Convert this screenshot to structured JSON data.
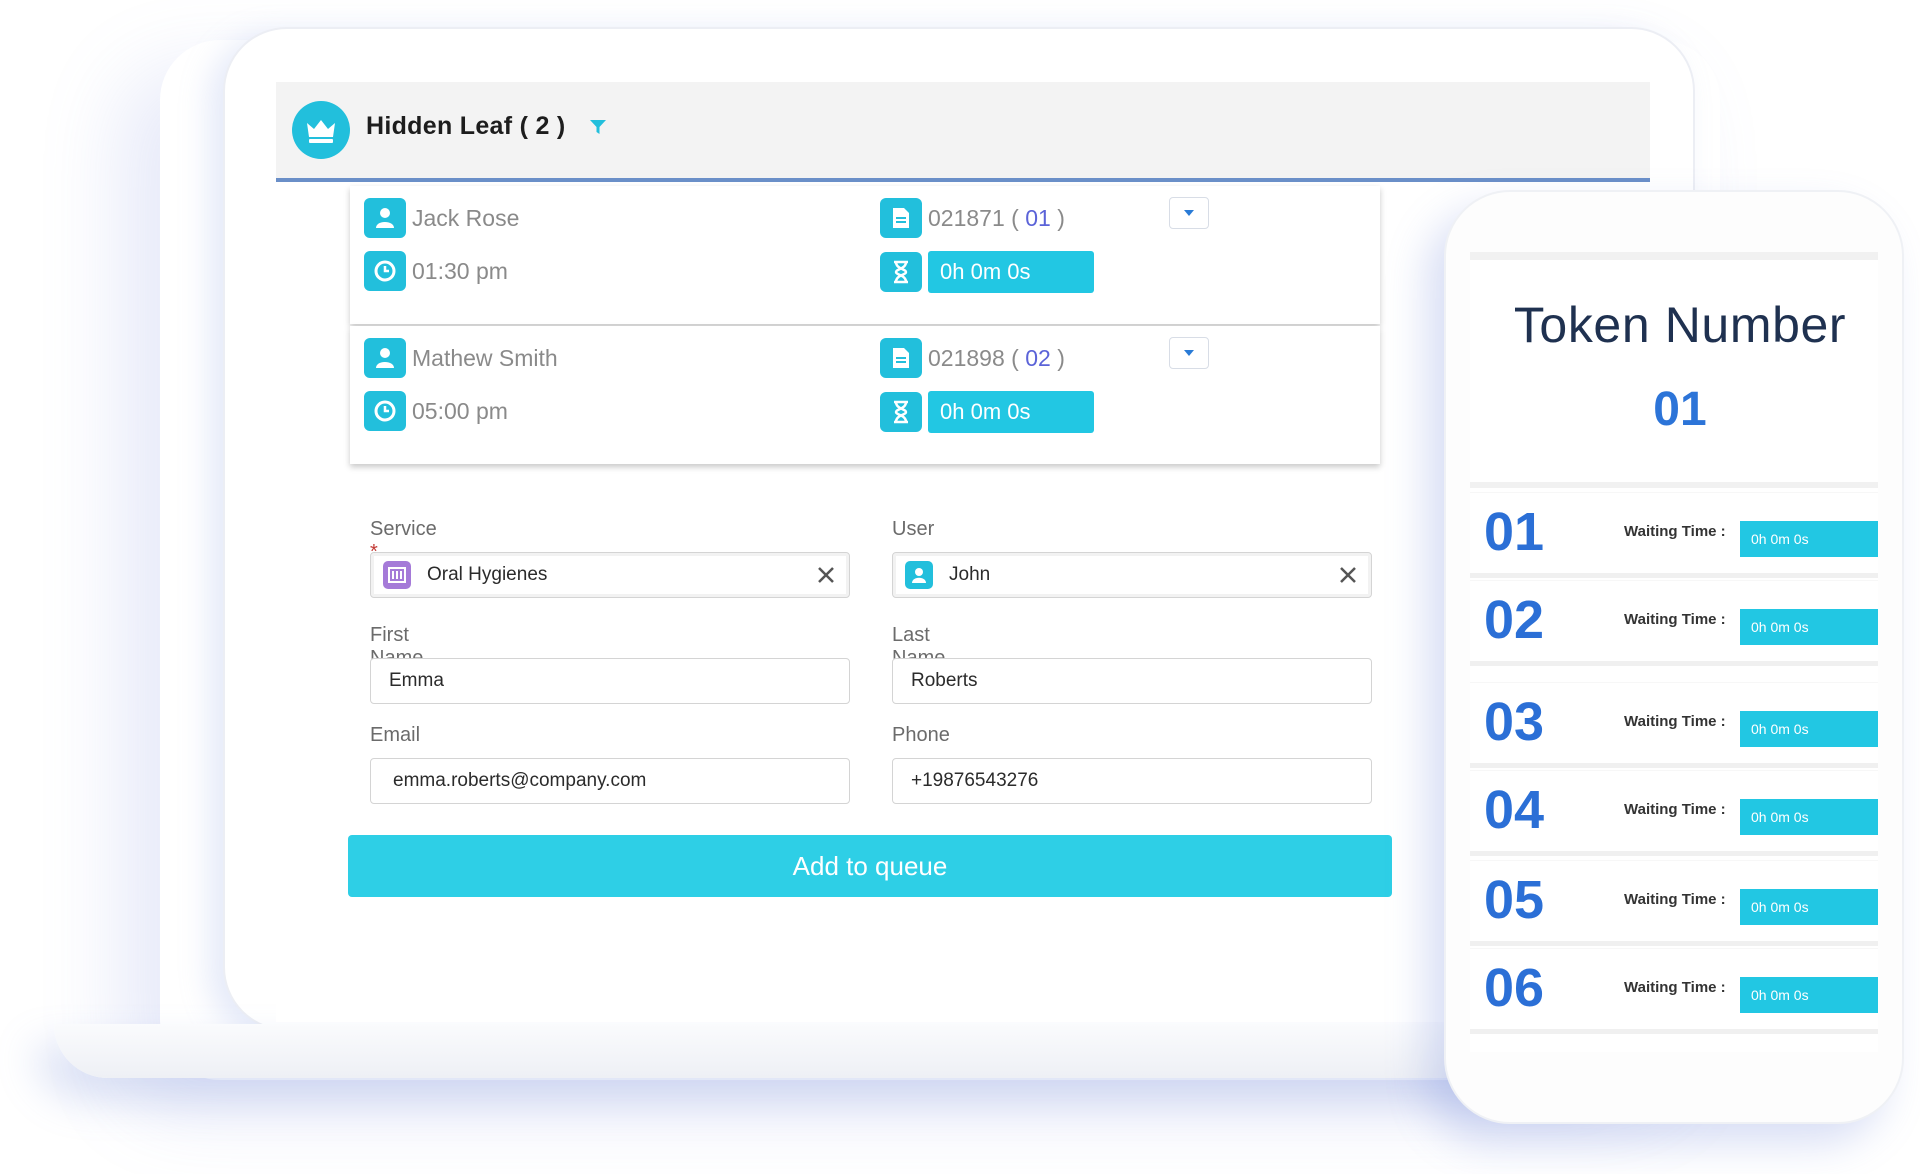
{
  "header": {
    "title": "Hidden Leaf ( 2 )"
  },
  "appointments": [
    {
      "name": "Jack Rose",
      "time": "01:30 pm",
      "token_id": "021871 (",
      "token_num": " 01 ",
      "token_close": ")",
      "timer": "0h 0m 0s"
    },
    {
      "name": "Mathew Smith",
      "time": "05:00 pm",
      "token_id": "021898 (",
      "token_num": " 02 ",
      "token_close": ")",
      "timer": "0h 0m 0s"
    }
  ],
  "form": {
    "service_label": "Service",
    "service_value": "Oral Hygienes",
    "user_label": "User",
    "user_value": "John",
    "first_name_label": "First Name",
    "first_name_value": "Emma",
    "last_name_label": "Last Name",
    "last_name_value": "Roberts",
    "email_label": "Email",
    "email_value": "emma.roberts@company.com",
    "phone_label": "Phone",
    "phone_value": "+19876543276",
    "required_mark": "*",
    "submit_label": "Add to queue"
  },
  "phone_display": {
    "title": "Token Number",
    "current": "01",
    "queue": [
      {
        "number": "01",
        "wait_label": "Waiting Time :",
        "wait_value": "0h 0m 0s"
      },
      {
        "number": "02",
        "wait_label": "Waiting Time :",
        "wait_value": "0h 0m 0s"
      },
      {
        "number": "03",
        "wait_label": "Waiting Time :",
        "wait_value": "0h 0m 0s"
      },
      {
        "number": "04",
        "wait_label": "Waiting Time :",
        "wait_value": "0h 0m 0s"
      },
      {
        "number": "05",
        "wait_label": "Waiting Time :",
        "wait_value": "0h 0m 0s"
      },
      {
        "number": "06",
        "wait_label": "Waiting Time :",
        "wait_value": "0h 0m 0s"
      }
    ]
  },
  "icons": {
    "header_badge": "crown-icon",
    "filter": "filter-icon",
    "person": "person-icon",
    "clock": "clock-icon",
    "document": "document-icon",
    "hourglass": "hourglass-icon",
    "dropdown": "chevron-down-icon",
    "service": "service-icon",
    "user": "contact-icon",
    "clear": "close-icon"
  },
  "colors": {
    "accent": "#22bfdc",
    "token_blue": "#2b6fd6",
    "token_link": "#5b63d8",
    "required": "#c23934",
    "service_icon": "#a57ad8"
  }
}
